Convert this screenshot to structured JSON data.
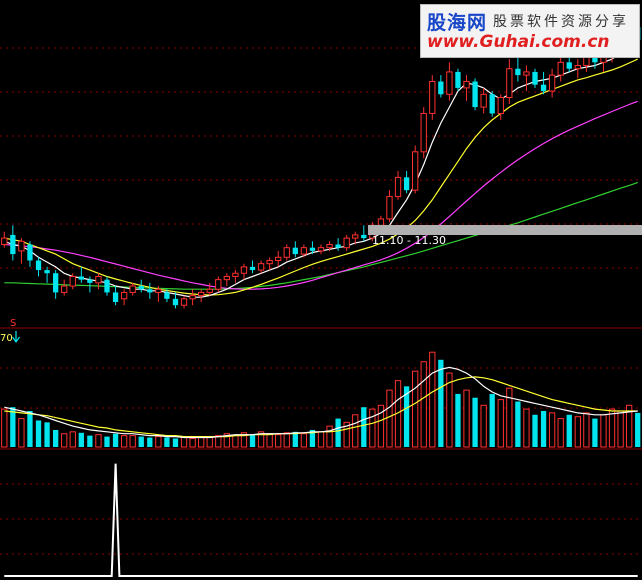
{
  "watermark": {
    "logo": "股海网",
    "slogan": "股票软件资源分享",
    "url": "www.Guhai.com.cn"
  },
  "colors": {
    "background": "#000000",
    "grid": "#8b0000",
    "up": "#ff3030",
    "down": "#00e5ee",
    "ma5": "#ffffff",
    "ma10": "#ffff30",
    "ma20": "#ff40ff",
    "ma60": "#30d030",
    "annotation_bar": "#b0b0b0",
    "signal": "#ffffff"
  },
  "annotations": {
    "date_range": "11.10 - 11.30",
    "signal_marker": "S",
    "axis_fragment": "70"
  },
  "chart_data": [
    {
      "type": "candlestick",
      "panel": "price",
      "ohlc": [
        [
          9.5,
          9.9,
          9.4,
          9.7
        ],
        [
          9.8,
          10.1,
          9.0,
          9.2
        ],
        [
          9.3,
          9.7,
          8.9,
          9.6
        ],
        [
          9.5,
          9.6,
          8.8,
          9.0
        ],
        [
          9.0,
          9.1,
          8.5,
          8.7
        ],
        [
          8.7,
          8.8,
          8.3,
          8.6
        ],
        [
          8.6,
          8.7,
          7.8,
          8.0
        ],
        [
          8.0,
          8.4,
          7.9,
          8.2
        ],
        [
          8.2,
          8.6,
          8.1,
          8.5
        ],
        [
          8.5,
          8.8,
          8.3,
          8.4
        ],
        [
          8.4,
          8.5,
          8.0,
          8.3
        ],
        [
          8.3,
          8.6,
          8.1,
          8.5
        ],
        [
          8.4,
          8.5,
          7.9,
          8.0
        ],
        [
          8.0,
          8.2,
          7.6,
          7.7
        ],
        [
          7.8,
          8.1,
          7.6,
          8.0
        ],
        [
          8.0,
          8.3,
          7.9,
          8.2
        ],
        [
          8.2,
          8.4,
          8.0,
          8.1
        ],
        [
          8.1,
          8.3,
          7.8,
          8.0
        ],
        [
          8.0,
          8.2,
          7.7,
          8.1
        ],
        [
          8.0,
          8.1,
          7.7,
          7.8
        ],
        [
          7.8,
          8.0,
          7.5,
          7.6
        ],
        [
          7.6,
          7.9,
          7.5,
          7.8
        ],
        [
          7.8,
          8.1,
          7.6,
          7.9
        ],
        [
          7.9,
          8.1,
          7.7,
          8.0
        ],
        [
          8.0,
          8.3,
          7.9,
          8.1
        ],
        [
          8.1,
          8.5,
          8.0,
          8.4
        ],
        [
          8.4,
          8.6,
          8.2,
          8.5
        ],
        [
          8.5,
          8.7,
          8.3,
          8.6
        ],
        [
          8.6,
          8.9,
          8.4,
          8.8
        ],
        [
          8.8,
          9.0,
          8.6,
          8.7
        ],
        [
          8.7,
          9.0,
          8.6,
          8.9
        ],
        [
          8.9,
          9.1,
          8.7,
          9.0
        ],
        [
          9.0,
          9.3,
          8.8,
          9.1
        ],
        [
          9.1,
          9.5,
          9.0,
          9.4
        ],
        [
          9.4,
          9.6,
          9.1,
          9.2
        ],
        [
          9.2,
          9.5,
          9.1,
          9.4
        ],
        [
          9.4,
          9.6,
          9.2,
          9.3
        ],
        [
          9.3,
          9.5,
          9.2,
          9.4
        ],
        [
          9.4,
          9.6,
          9.3,
          9.5
        ],
        [
          9.5,
          9.7,
          9.3,
          9.4
        ],
        [
          9.4,
          9.8,
          9.3,
          9.7
        ],
        [
          9.7,
          9.9,
          9.5,
          9.8
        ],
        [
          9.8,
          10.1,
          9.6,
          9.7
        ],
        [
          9.7,
          10.2,
          9.6,
          10.1
        ],
        [
          10.1,
          10.4,
          10.0,
          10.3
        ],
        [
          10.3,
          11.2,
          10.2,
          11.0
        ],
        [
          11.0,
          11.8,
          10.9,
          11.6
        ],
        [
          11.6,
          11.8,
          11.1,
          11.2
        ],
        [
          11.2,
          12.6,
          11.1,
          12.4
        ],
        [
          12.4,
          13.8,
          12.2,
          13.6
        ],
        [
          13.6,
          14.8,
          13.4,
          14.6
        ],
        [
          14.6,
          14.8,
          14.1,
          14.2
        ],
        [
          14.2,
          15.2,
          14.0,
          14.9
        ],
        [
          14.9,
          15.0,
          14.3,
          14.4
        ],
        [
          14.4,
          14.8,
          14.0,
          14.6
        ],
        [
          14.6,
          14.7,
          13.7,
          13.8
        ],
        [
          13.8,
          14.4,
          13.6,
          14.2
        ],
        [
          14.2,
          14.3,
          13.5,
          13.6
        ],
        [
          13.6,
          14.2,
          13.4,
          14.1
        ],
        [
          14.1,
          15.3,
          13.9,
          15.0
        ],
        [
          15.0,
          15.4,
          14.6,
          14.8
        ],
        [
          14.8,
          15.1,
          14.3,
          14.9
        ],
        [
          14.9,
          15.0,
          14.4,
          14.5
        ],
        [
          14.5,
          14.9,
          14.2,
          14.3
        ],
        [
          14.3,
          15.0,
          14.1,
          14.8
        ],
        [
          14.8,
          15.4,
          14.6,
          15.2
        ],
        [
          15.2,
          15.6,
          14.9,
          15.0
        ],
        [
          15.0,
          15.3,
          14.7,
          15.1
        ],
        [
          15.1,
          15.6,
          14.9,
          15.4
        ],
        [
          15.4,
          15.7,
          15.0,
          15.2
        ],
        [
          15.2,
          15.6,
          14.9,
          15.4
        ],
        [
          15.4,
          15.9,
          15.2,
          15.7
        ],
        [
          15.7,
          16.2,
          15.5,
          16.0
        ],
        [
          16.0,
          16.6,
          15.8,
          16.3
        ],
        [
          16.3,
          16.5,
          15.7,
          15.9
        ]
      ],
      "ma5": [
        9.6,
        9.5,
        9.45,
        9.3,
        9.1,
        8.95,
        8.8,
        8.6,
        8.5,
        8.45,
        8.4,
        8.35,
        8.3,
        8.2,
        8.15,
        8.1,
        8.1,
        8.05,
        8.05,
        8.0,
        7.95,
        7.9,
        7.85,
        7.85,
        7.9,
        8.0,
        8.1,
        8.25,
        8.4,
        8.5,
        8.6,
        8.7,
        8.8,
        8.95,
        9.05,
        9.15,
        9.25,
        9.3,
        9.35,
        9.4,
        9.45,
        9.55,
        9.6,
        9.7,
        9.85,
        10.1,
        10.5,
        10.9,
        11.4,
        12.0,
        12.7,
        13.3,
        13.8,
        14.3,
        14.55,
        14.5,
        14.4,
        14.2,
        14.05,
        14.2,
        14.4,
        14.5,
        14.6,
        14.65,
        14.7,
        14.8,
        14.9,
        15.0,
        15.05,
        15.1,
        15.2,
        15.3,
        15.5,
        15.7,
        15.85
      ],
      "ma10": [
        9.7,
        9.65,
        9.6,
        9.5,
        9.4,
        9.3,
        9.2,
        9.05,
        8.9,
        8.8,
        8.7,
        8.6,
        8.5,
        8.42,
        8.35,
        8.28,
        8.22,
        8.16,
        8.1,
        8.06,
        8.02,
        7.98,
        7.95,
        7.93,
        7.92,
        7.93,
        7.96,
        8.0,
        8.08,
        8.16,
        8.25,
        8.35,
        8.45,
        8.56,
        8.67,
        8.78,
        8.88,
        8.97,
        9.05,
        9.12,
        9.2,
        9.28,
        9.36,
        9.44,
        9.54,
        9.67,
        9.83,
        10.02,
        10.25,
        10.55,
        10.9,
        11.3,
        11.7,
        12.1,
        12.5,
        12.85,
        13.15,
        13.4,
        13.6,
        13.8,
        13.95,
        14.05,
        14.15,
        14.25,
        14.35,
        14.45,
        14.55,
        14.65,
        14.72,
        14.8,
        14.88,
        14.96,
        15.06,
        15.18,
        15.3
      ],
      "ma20": [
        9.5,
        9.48,
        9.46,
        9.43,
        9.4,
        9.36,
        9.32,
        9.27,
        9.22,
        9.16,
        9.1,
        9.03,
        8.96,
        8.89,
        8.82,
        8.75,
        8.68,
        8.61,
        8.54,
        8.48,
        8.42,
        8.36,
        8.3,
        8.25,
        8.2,
        8.16,
        8.13,
        8.11,
        8.1,
        8.1,
        8.11,
        8.13,
        8.16,
        8.2,
        8.25,
        8.31,
        8.38,
        8.46,
        8.54,
        8.62,
        8.7,
        8.78,
        8.86,
        8.94,
        9.02,
        9.12,
        9.24,
        9.38,
        9.54,
        9.72,
        9.92,
        10.14,
        10.38,
        10.62,
        10.86,
        11.1,
        11.33,
        11.55,
        11.76,
        11.96,
        12.15,
        12.33,
        12.5,
        12.66,
        12.81,
        12.95,
        13.08,
        13.2,
        13.32,
        13.44,
        13.55,
        13.66,
        13.77,
        13.88,
        13.98
      ],
      "ma60": [
        8.3,
        8.3,
        8.29,
        8.28,
        8.27,
        8.26,
        8.25,
        8.24,
        8.23,
        8.22,
        8.21,
        8.2,
        8.19,
        8.18,
        8.17,
        8.16,
        8.15,
        8.14,
        8.13,
        8.12,
        8.11,
        8.1,
        8.1,
        8.1,
        8.1,
        8.1,
        8.11,
        8.12,
        8.14,
        8.16,
        8.19,
        8.22,
        8.26,
        8.3,
        8.35,
        8.4,
        8.45,
        8.5,
        8.56,
        8.62,
        8.68,
        8.74,
        8.8,
        8.87,
        8.94,
        9.01,
        9.08,
        9.15,
        9.22,
        9.3,
        9.38,
        9.46,
        9.54,
        9.62,
        9.7,
        9.78,
        9.86,
        9.94,
        10.02,
        10.1,
        10.18,
        10.27,
        10.36,
        10.45,
        10.54,
        10.63,
        10.72,
        10.81,
        10.9,
        10.99,
        11.08,
        11.17,
        11.26,
        11.35,
        11.44
      ],
      "ylim": [
        7.2,
        16.9
      ]
    },
    {
      "type": "bar",
      "panel": "volume",
      "volume": [
        40,
        42,
        30,
        38,
        28,
        26,
        18,
        14,
        16,
        15,
        12,
        13,
        11,
        14,
        12,
        12,
        11,
        10,
        11,
        10,
        9,
        10,
        9,
        10,
        10,
        12,
        14,
        12,
        15,
        13,
        16,
        14,
        13,
        15,
        16,
        14,
        18,
        16,
        22,
        30,
        26,
        34,
        42,
        40,
        44,
        60,
        70,
        64,
        80,
        90,
        100,
        92,
        78,
        56,
        60,
        52,
        44,
        56,
        50,
        62,
        48,
        40,
        34,
        38,
        36,
        30,
        34,
        32,
        36,
        30,
        34,
        40,
        38,
        44,
        36
      ],
      "vma5": [
        42,
        40,
        38,
        36,
        34,
        31,
        28,
        25,
        22,
        20,
        18,
        17,
        16,
        15,
        14,
        14,
        13,
        12,
        12,
        11,
        11,
        10,
        10,
        10,
        10,
        11,
        12,
        13,
        13,
        13,
        14,
        14,
        14,
        14,
        15,
        15,
        16,
        16,
        17,
        20,
        22,
        25,
        29,
        32,
        36,
        42,
        50,
        56,
        62,
        70,
        78,
        82,
        84,
        82,
        78,
        72,
        64,
        58,
        54,
        52,
        50,
        48,
        46,
        44,
        42,
        40,
        38,
        36,
        35,
        34,
        34,
        35,
        36,
        37,
        38
      ],
      "vma10": [
        38,
        37,
        36,
        35,
        34,
        33,
        31,
        29,
        27,
        25,
        23,
        21,
        20,
        18,
        17,
        16,
        15,
        14,
        13,
        12,
        12,
        11,
        11,
        11,
        11,
        11,
        11,
        12,
        12,
        13,
        13,
        13,
        14,
        14,
        14,
        15,
        15,
        16,
        16,
        17,
        19,
        21,
        23,
        25,
        28,
        32,
        36,
        41,
        46,
        52,
        58,
        63,
        68,
        71,
        73,
        74,
        73,
        71,
        68,
        65,
        62,
        59,
        56,
        53,
        50,
        48,
        46,
        44,
        42,
        40,
        39,
        38,
        38,
        38,
        38
      ],
      "ylim": [
        0,
        115
      ]
    },
    {
      "type": "line",
      "panel": "indicator",
      "values": [
        0,
        0,
        0,
        0,
        0,
        0,
        0,
        0,
        0,
        0,
        0,
        0,
        0,
        0,
        0,
        0,
        0,
        0,
        0,
        0,
        0,
        0,
        0,
        0,
        0,
        0,
        0,
        0,
        0,
        0,
        0,
        0,
        0,
        0,
        0,
        0,
        0,
        0,
        0,
        0,
        0,
        0,
        0,
        0,
        0,
        0,
        0,
        0,
        0,
        0,
        0,
        0,
        0,
        0,
        0,
        0,
        0,
        0,
        0,
        0,
        0,
        0,
        0,
        0,
        0,
        0,
        0,
        0,
        0,
        0,
        0,
        0,
        0,
        0,
        0
      ],
      "spike_index": 13,
      "spike_value": 1,
      "ylim": [
        0,
        1.05
      ]
    }
  ]
}
